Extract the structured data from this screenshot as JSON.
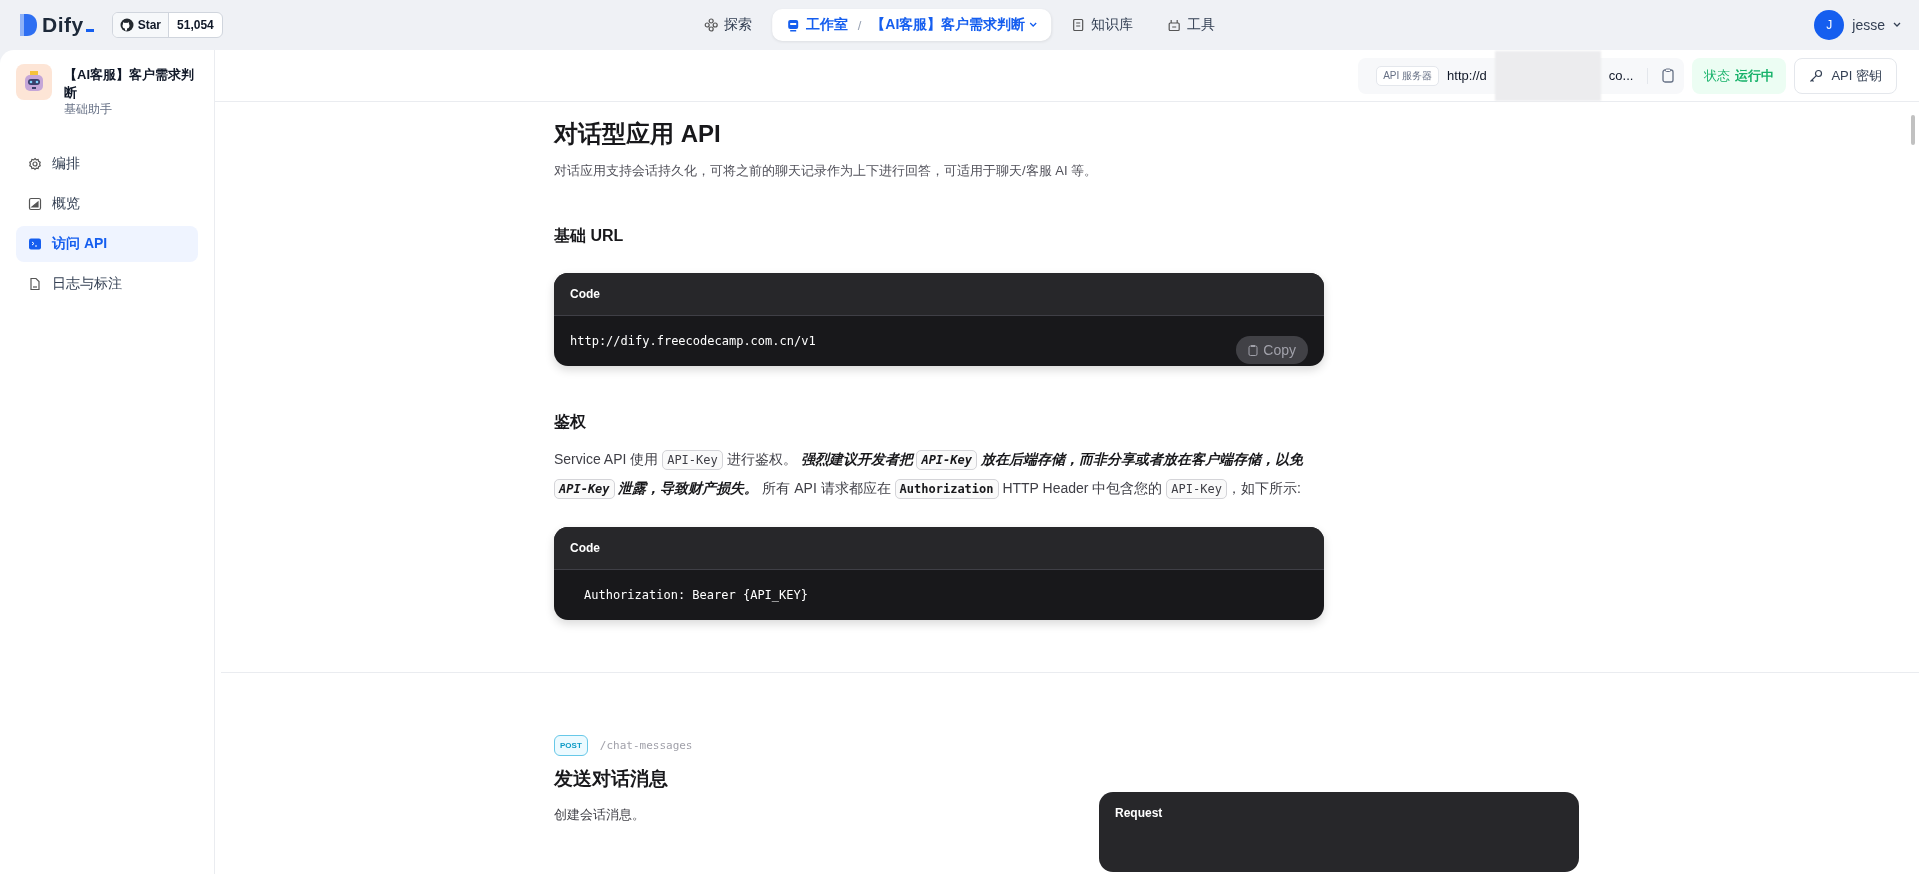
{
  "topbar": {
    "logo": "Dify",
    "github": {
      "label": "Star",
      "count": "51,054"
    },
    "nav": [
      {
        "label": "探索",
        "kind": "explore",
        "selected": false
      },
      {
        "label": "工作室",
        "kind": "studio",
        "selected": true,
        "separator": "/",
        "app": "【AI客服】客户需求判断"
      },
      {
        "label": "知识库",
        "kind": "knowledge",
        "selected": false
      },
      {
        "label": "工具",
        "kind": "tools",
        "selected": false
      }
    ],
    "user": {
      "initial": "J",
      "name": "jesse"
    }
  },
  "sidebar": {
    "app_name": "【AI客服】客户需求判断",
    "app_type": "基础助手",
    "items": [
      {
        "label": "编排",
        "kind": "orchestrate",
        "selected": false
      },
      {
        "label": "概览",
        "kind": "overview",
        "selected": false
      },
      {
        "label": "访问 API",
        "kind": "api",
        "selected": true
      },
      {
        "label": "日志与标注",
        "kind": "logs",
        "selected": false
      }
    ]
  },
  "api_header": {
    "server_tag": "API 服务器",
    "url_start": "http://d",
    "url_end": "co...",
    "status_label": "状态",
    "status_value": "运行中",
    "key_button": "API 密钥"
  },
  "content": {
    "title": "对话型应用 API",
    "description": "对话应用支持会话持久化，可将之前的聊天记录作为上下进行回答，可适用于聊天/客服 AI 等。",
    "base_url": {
      "heading": "基础 URL",
      "code_title": "Code",
      "code": "http://dify.freecodecamp.com.cn/v1",
      "copy": "Copy"
    },
    "auth": {
      "heading": "鉴权",
      "paragraph": [
        {
          "kind": "text",
          "text": "Service API 使用 "
        },
        {
          "kind": "code",
          "text": "API-Key"
        },
        {
          "kind": "text",
          "text": " 进行鉴权。 "
        },
        {
          "kind": "strong",
          "text": "强烈建议开发者把 "
        },
        {
          "kind": "strong-code",
          "text": "API-Key"
        },
        {
          "kind": "strong",
          "text": " 放在后端存储，而非分享或者放在客户端存储，以免 "
        },
        {
          "kind": "strong-code",
          "text": "API-Key"
        },
        {
          "kind": "strong",
          "text": " 泄露，导致财产损失。"
        },
        {
          "kind": "text",
          "text": " 所有 API 请求都应在 "
        },
        {
          "kind": "code-bold",
          "text": "Authorization"
        },
        {
          "kind": "text",
          "text": " HTTP Header 中包含您的 "
        },
        {
          "kind": "code",
          "text": "API-Key"
        },
        {
          "kind": "text",
          "text": "，如下所示:"
        }
      ],
      "code_title": "Code",
      "code": "Authorization: Bearer {API_KEY}"
    },
    "endpoint": {
      "method": "POST",
      "path": "/chat-messages",
      "title": "发送对话消息",
      "description": "创建会话消息。",
      "request_title": "Request"
    }
  }
}
